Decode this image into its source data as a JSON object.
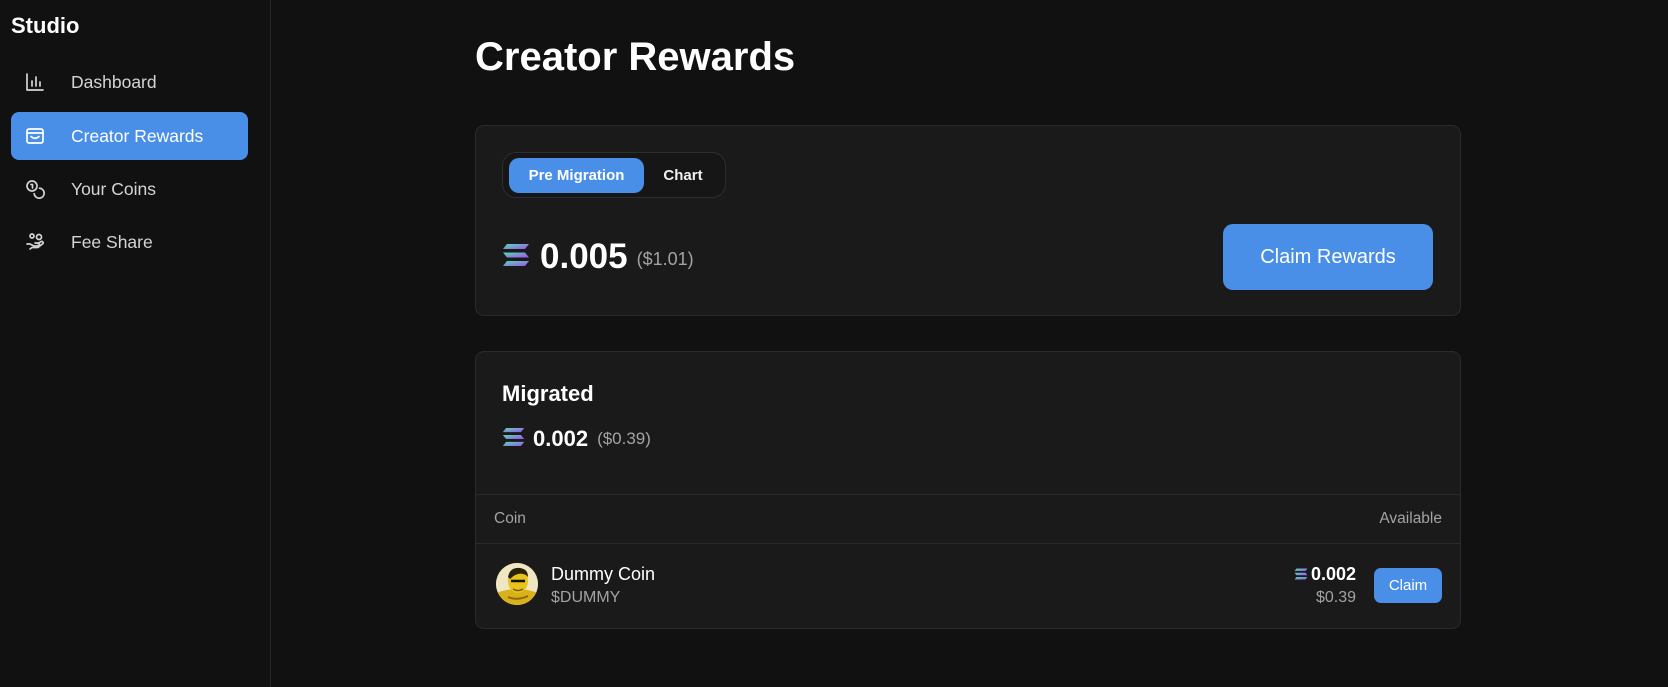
{
  "sidebar": {
    "brand": "Studio",
    "items": [
      {
        "label": "Dashboard",
        "icon": "bar-chart-icon",
        "active": false
      },
      {
        "label": "Creator Rewards",
        "icon": "wallet-icon",
        "active": true
      },
      {
        "label": "Your Coins",
        "icon": "coins-icon",
        "active": false
      },
      {
        "label": "Fee Share",
        "icon": "hand-coins-icon",
        "active": false
      }
    ]
  },
  "main": {
    "title": "Creator Rewards",
    "tabs": [
      {
        "label": "Pre Migration",
        "active": true
      },
      {
        "label": "Chart",
        "active": false
      }
    ],
    "pre_migration": {
      "amount": "0.005",
      "usd": "($1.01)",
      "claim_label": "Claim Rewards"
    },
    "migrated": {
      "title": "Migrated",
      "amount": "0.002",
      "usd": "($0.39)",
      "table": {
        "headers": {
          "coin": "Coin",
          "available": "Available"
        },
        "rows": [
          {
            "name": "Dummy Coin",
            "ticker": "$DUMMY",
            "amount": "0.002",
            "usd": "$0.39",
            "claim_label": "Claim"
          }
        ]
      }
    }
  },
  "colors": {
    "accent": "#4a8fe7",
    "background": "#111111",
    "card": "#1a1a1a",
    "muted_text": "#a3a3a3"
  }
}
